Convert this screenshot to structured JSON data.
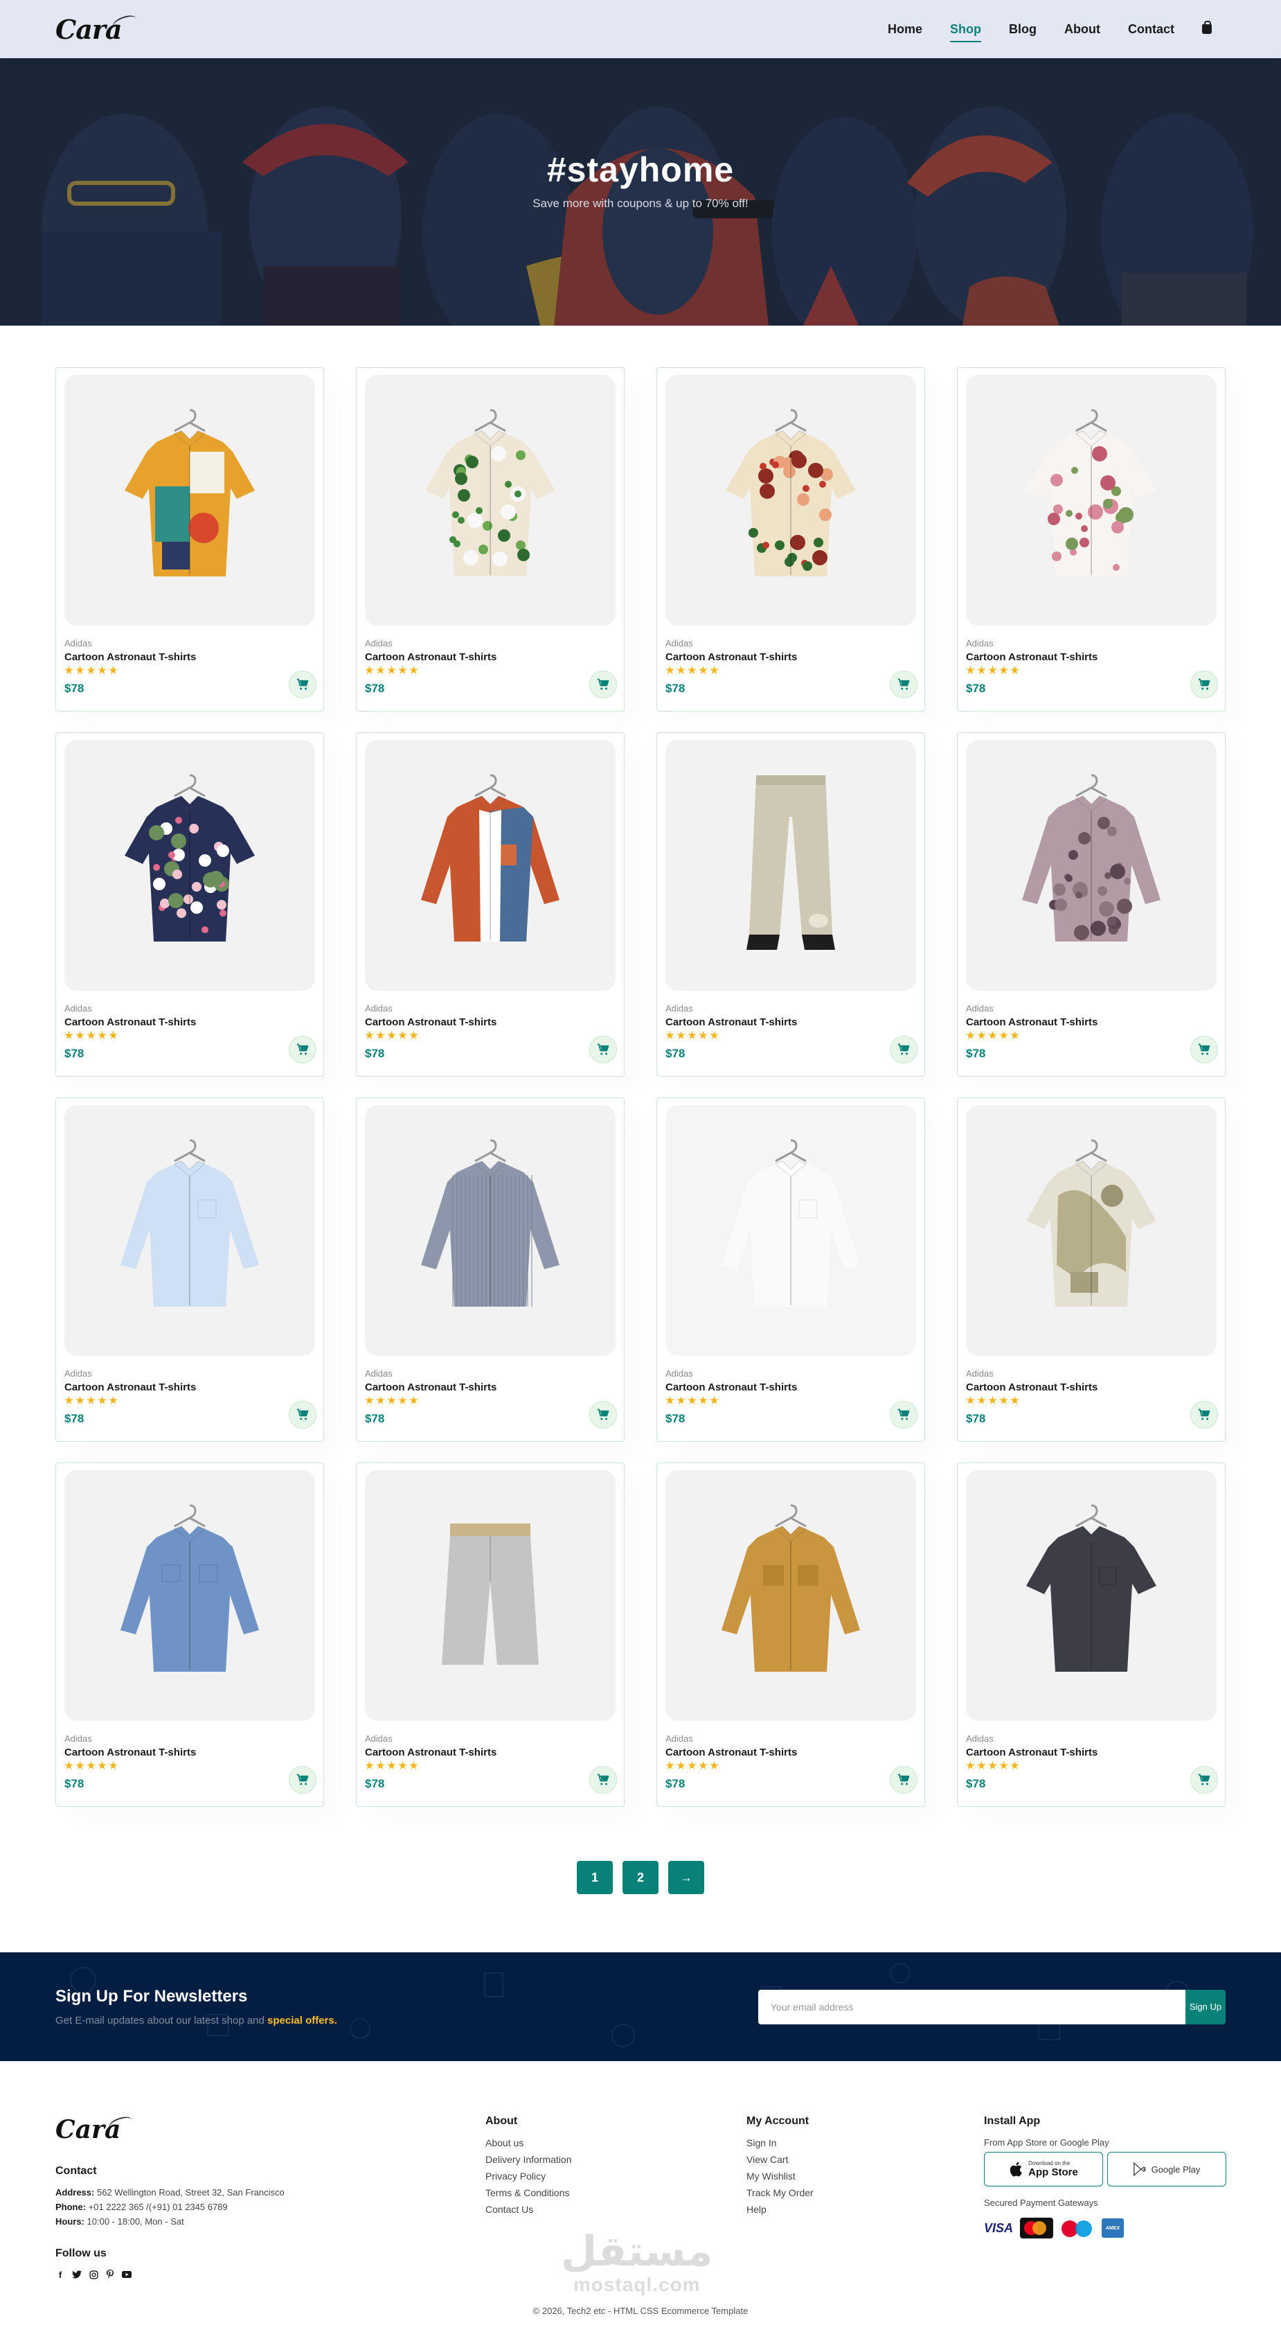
{
  "brand": {
    "logo_text": "Cara"
  },
  "nav": {
    "items": [
      {
        "label": "Home",
        "active": false
      },
      {
        "label": "Shop",
        "active": true
      },
      {
        "label": "Blog",
        "active": false
      },
      {
        "label": "About",
        "active": false
      },
      {
        "label": "Contact",
        "active": false
      }
    ],
    "cart_icon": "shopping-bag-icon"
  },
  "hero": {
    "title": "#stayhome",
    "subtitle": "Save more with coupons & up to 70% off!"
  },
  "products": [
    {
      "brand": "Adidas",
      "title": "Cartoon Astronaut T-shirts",
      "price": "$78",
      "rating": 5,
      "image": "patterned-shirt-abstract"
    },
    {
      "brand": "Adidas",
      "title": "Cartoon Astronaut T-shirts",
      "price": "$78",
      "rating": 5,
      "image": "floral-shirt-green"
    },
    {
      "brand": "Adidas",
      "title": "Cartoon Astronaut T-shirts",
      "price": "$78",
      "rating": 5,
      "image": "floral-shirt-red"
    },
    {
      "brand": "Adidas",
      "title": "Cartoon Astronaut T-shirts",
      "price": "$78",
      "rating": 5,
      "image": "floral-shirt-white"
    },
    {
      "brand": "Adidas",
      "title": "Cartoon Astronaut T-shirts",
      "price": "$78",
      "rating": 5,
      "image": "floral-shirt-navy"
    },
    {
      "brand": "Adidas",
      "title": "Cartoon Astronaut T-shirts",
      "price": "$78",
      "rating": 5,
      "image": "colorblock-shirt"
    },
    {
      "brand": "Adidas",
      "title": "Cartoon Astronaut T-shirts",
      "price": "$78",
      "rating": 5,
      "image": "linen-trousers"
    },
    {
      "brand": "Adidas",
      "title": "Cartoon Astronaut T-shirts",
      "price": "$78",
      "rating": 5,
      "image": "paisley-blouse"
    },
    {
      "brand": "Adidas",
      "title": "Cartoon Astronaut T-shirts",
      "price": "$78",
      "rating": 5,
      "image": "light-blue-shirt"
    },
    {
      "brand": "Adidas",
      "title": "Cartoon Astronaut T-shirts",
      "price": "$78",
      "rating": 5,
      "image": "grey-striped-shirt"
    },
    {
      "brand": "Adidas",
      "title": "Cartoon Astronaut T-shirts",
      "price": "$78",
      "rating": 5,
      "image": "white-shirt"
    },
    {
      "brand": "Adidas",
      "title": "Cartoon Astronaut T-shirts",
      "price": "$78",
      "rating": 5,
      "image": "camo-print-shirt"
    },
    {
      "brand": "Adidas",
      "title": "Cartoon Astronaut T-shirts",
      "price": "$78",
      "rating": 5,
      "image": "denim-blue-shirt"
    },
    {
      "brand": "Adidas",
      "title": "Cartoon Astronaut T-shirts",
      "price": "$78",
      "rating": 5,
      "image": "grey-shorts"
    },
    {
      "brand": "Adidas",
      "title": "Cartoon Astronaut T-shirts",
      "price": "$78",
      "rating": 5,
      "image": "tan-overshirt"
    },
    {
      "brand": "Adidas",
      "title": "Cartoon Astronaut T-shirts",
      "price": "$78",
      "rating": 5,
      "image": "charcoal-shirt"
    }
  ],
  "pagination": {
    "pages": [
      "1",
      "2"
    ],
    "next_label": "→"
  },
  "newsletter": {
    "title": "Sign Up For Newsletters",
    "subtitle_prefix": "Get E-mail updates about our latest shop and",
    "subtitle_highlight": "special offers.",
    "input_placeholder": "Your email address",
    "button_label": "Sign Up"
  },
  "footer": {
    "logo_text": "Cara",
    "contact": {
      "heading": "Contact",
      "address_label": "Address:",
      "address": "562 Wellington Road, Street 32, San Francisco",
      "phone_label": "Phone:",
      "phone": "+01 2222 365 /(+91) 01 2345 6789",
      "hours_label": "Hours:",
      "hours": "10:00 - 18:00, Mon - Sat"
    },
    "follow_heading": "Follow us",
    "socials": [
      "facebook-icon",
      "twitter-icon",
      "instagram-icon",
      "pinterest-icon",
      "youtube-icon"
    ],
    "about": {
      "heading": "About",
      "links": [
        "About us",
        "Delivery Information",
        "Privacy Policy",
        "Terms & Conditions",
        "Contact Us"
      ]
    },
    "account": {
      "heading": "My Account",
      "links": [
        "Sign In",
        "View Cart",
        "My Wishlist",
        "Track My Order",
        "Help"
      ]
    },
    "install": {
      "heading": "Install App",
      "subtitle": "From App Store or Google Play",
      "app_store_small": "Download on the",
      "app_store_big": "App Store",
      "google_play": "Google Play",
      "payment_heading": "Secured Payment Gateways",
      "payments": [
        "VISA",
        "MasterCard",
        "Maestro",
        "AMEX"
      ]
    },
    "copyright": "© 2026, Tech2 etc - HTML CSS Ecommerce Template",
    "watermark_ar": "مستقل",
    "watermark_en": "mostaql.com"
  },
  "colors": {
    "accent": "#088178",
    "header_bg": "#e3e6f3",
    "newsletter_bg": "#041e42",
    "star": "#f3b519",
    "highlight": "#ffbd27"
  }
}
